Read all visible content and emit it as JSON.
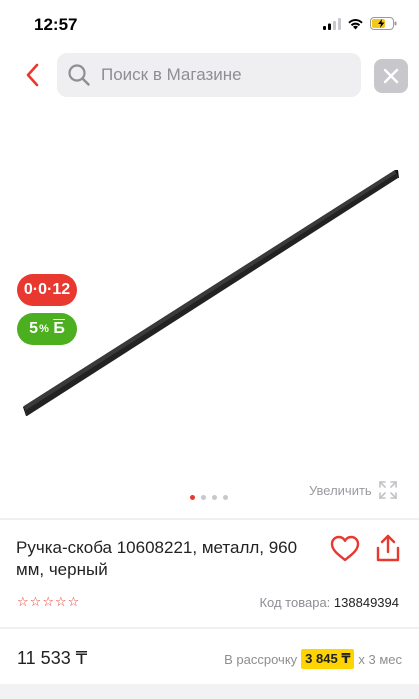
{
  "status_bar": {
    "time": "12:57"
  },
  "header": {
    "search_placeholder": "Поиск в Магазине",
    "back_icon": "chevron-left-icon",
    "close_icon": "close-icon"
  },
  "gallery": {
    "badge_installment": "0·0·12",
    "badge_bonus_value": "5",
    "badge_bonus_suffix": "%",
    "badge_bonus_currency": "Б",
    "zoom_label": "Увеличить",
    "slides_total": 4,
    "active_slide": 1
  },
  "product": {
    "title": "Ручка-скоба 10608221, металл, 960 мм, черный",
    "code_label": "Код товара:",
    "code_value": "138849394",
    "rating_stars": 5,
    "rating_value": 0
  },
  "price": {
    "value": "11 533 ₸",
    "installment_label": "В рассрочку",
    "installment_amount": "3 845 ₸",
    "installment_term": "х 3 мес"
  },
  "colors": {
    "accent": "#e8382f",
    "bonus_green": "#4caf1f",
    "installment_yellow": "#ffd400"
  }
}
